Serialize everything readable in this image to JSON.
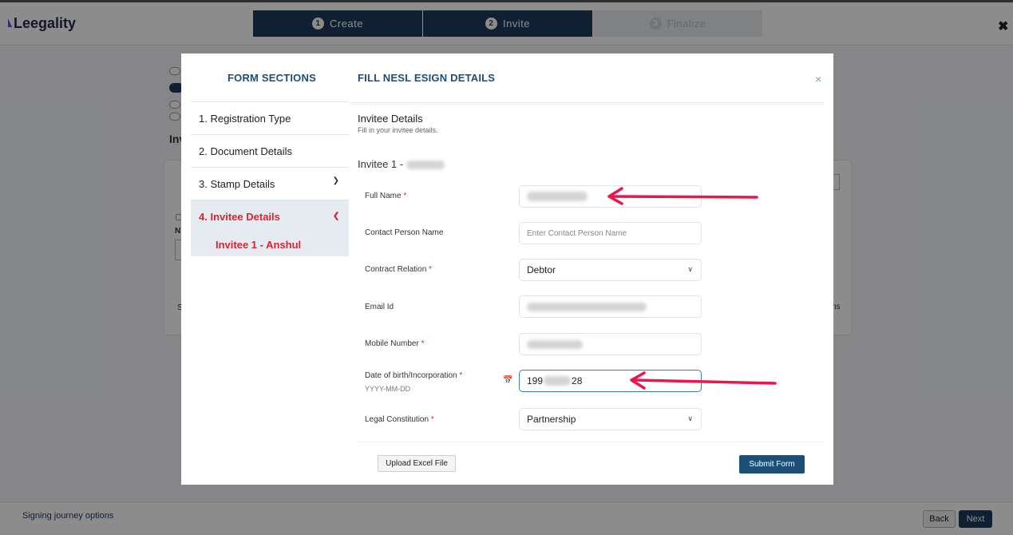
{
  "app": {
    "brand": "Leegality",
    "steps": [
      {
        "num": "1",
        "label": "Create"
      },
      {
        "num": "2",
        "label": "Invite"
      },
      {
        "num": "3",
        "label": "Finalize"
      }
    ],
    "close_icon": "close-icon"
  },
  "footer": {
    "signing_journey": "Signing journey options",
    "back_label": "Back",
    "next_label": "Next"
  },
  "modal": {
    "sections_title": "FORM SECTIONS",
    "form_title": "FILL NESL ESIGN DETAILS",
    "close_glyph": "×",
    "sections": [
      {
        "label": "1. Registration Type"
      },
      {
        "label": "2. Document Details"
      },
      {
        "label": "3. Stamp Details"
      },
      {
        "label": "4. Invitee Details"
      }
    ],
    "active_sub": "Invitee 1 - Anshul",
    "invitee_details_title": "Invitee Details",
    "invitee_details_desc": "Fill in your invitee details.",
    "invitee_heading": "Invitee 1 -",
    "fields": {
      "full_name_label": "Full Name",
      "contact_person_label": "Contact Person Name",
      "contact_person_placeholder": "Enter Contact Person Name",
      "contract_relation_label": "Contract Relation",
      "contract_relation_value": "Debtor",
      "email_label": "Email Id",
      "mobile_label": "Mobile Number",
      "dob_label": "Date of birth/Incorporation",
      "dob_hint": "YYYY-MM-DD",
      "dob_value_start": "199",
      "dob_value_end": "28",
      "legal_constitution_label": "Legal Constitution",
      "legal_constitution_value": "Partnership"
    },
    "upload_label": "Upload Excel File",
    "submit_label": "Submit Form"
  },
  "colors": {
    "primary": "#1b4f78",
    "active_red": "#d9252f",
    "annotation_arrow": "#e8174f"
  }
}
